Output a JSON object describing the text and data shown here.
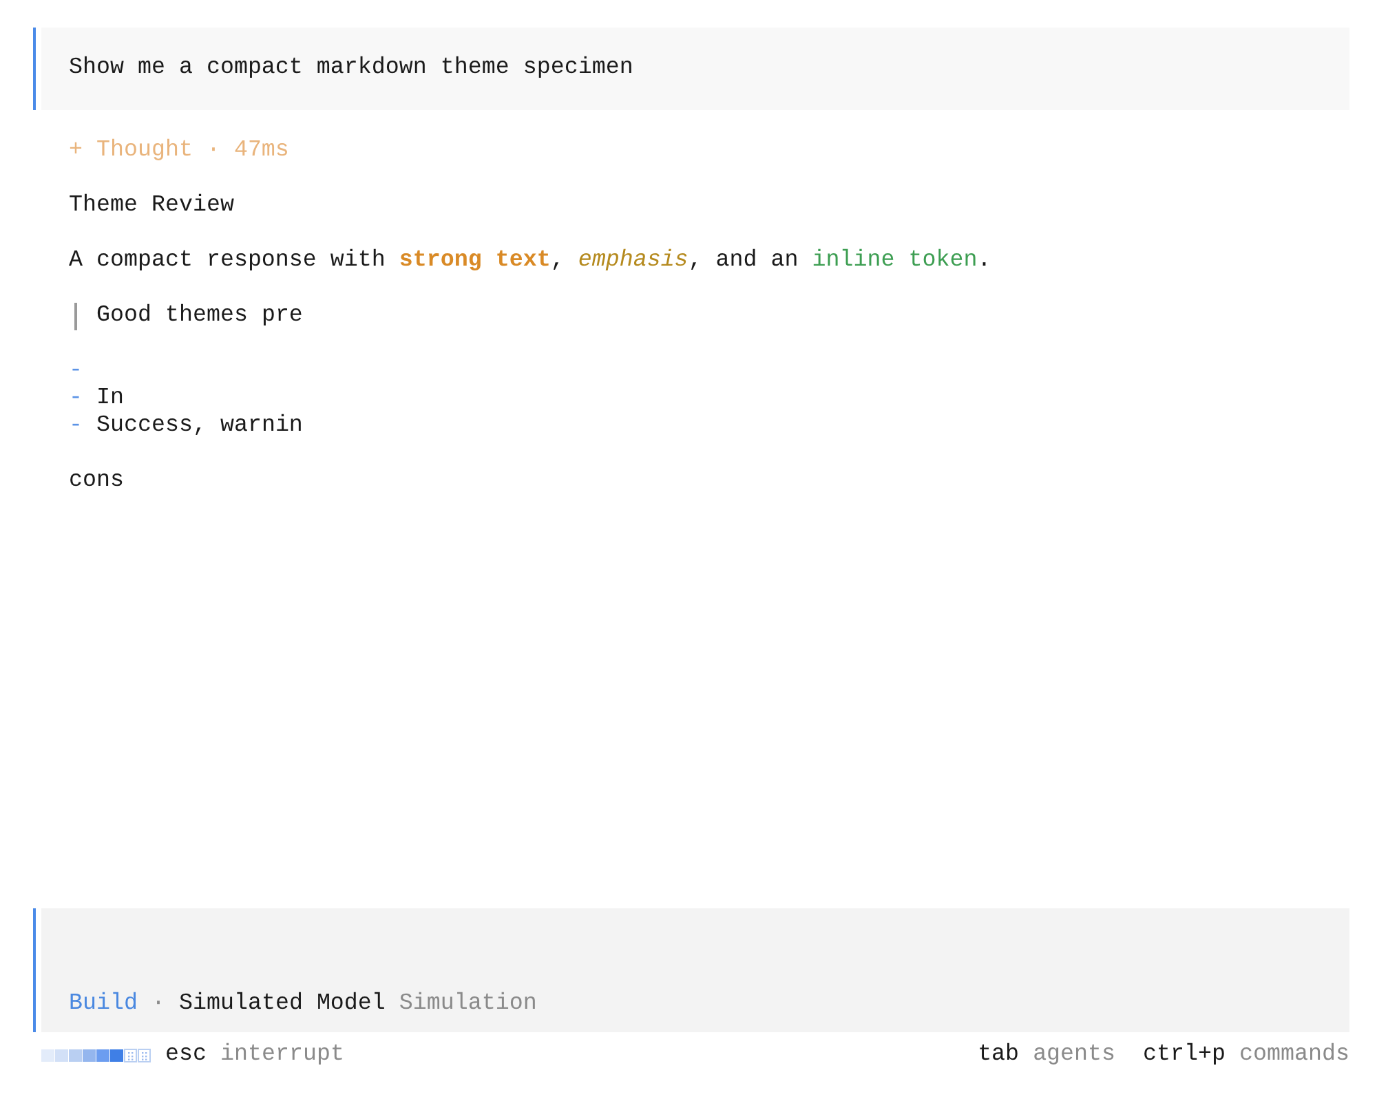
{
  "user_message": {
    "text": "Show me a compact markdown theme specimen"
  },
  "thought": {
    "text": "+ Thought · 47ms"
  },
  "response": {
    "blocks": [
      {
        "kind": "heading",
        "text": "Theme Review"
      },
      {
        "kind": "paragraph",
        "segments": [
          {
            "kind": "plain",
            "text": "A compact response with "
          },
          {
            "kind": "strong",
            "text": "strong text"
          },
          {
            "kind": "plain",
            "text": ", "
          },
          {
            "kind": "emphasis",
            "text": "emphasis"
          },
          {
            "kind": "plain",
            "text": ", and an "
          },
          {
            "kind": "code",
            "text": "inline token"
          },
          {
            "kind": "plain",
            "text": "."
          }
        ]
      },
      {
        "kind": "quote",
        "text": "Good themes pre"
      },
      {
        "kind": "list",
        "items": [
          {
            "marker": "-"
          },
          {
            "marker": "-",
            "text": "In"
          },
          {
            "marker": "-",
            "text": "Success, warnin"
          }
        ]
      },
      {
        "kind": "paragraph",
        "segments": [
          {
            "kind": "plain",
            "text": "cons"
          }
        ]
      }
    ]
  },
  "prompt": {
    "agent": "Build",
    "separator": "·",
    "model": "Simulated Model",
    "provider": "Simulation"
  },
  "status_bar": {
    "left_hints": [
      {
        "key": "esc",
        "label": "interrupt"
      }
    ],
    "right_hints": [
      {
        "key": "tab",
        "label": "agents"
      },
      {
        "key": "ctrl+p",
        "label": "commands"
      }
    ]
  }
}
